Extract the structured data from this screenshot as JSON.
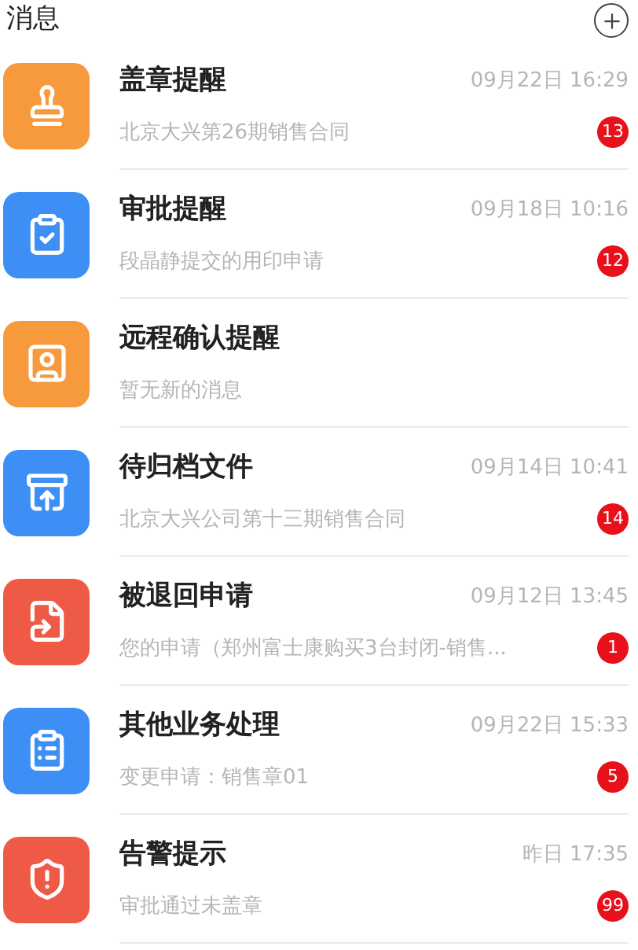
{
  "header": {
    "title": "消息"
  },
  "messages": [
    {
      "title": "盖章提醒",
      "time": "09月22日 16:29",
      "preview": "北京大兴第26期销售合同",
      "badge": "13",
      "color": "#f79a3e"
    },
    {
      "title": "审批提醒",
      "time": "09月18日 10:16",
      "preview": "段晶静提交的用印申请",
      "badge": "12",
      "color": "#3d8ff5"
    },
    {
      "title": "远程确认提醒",
      "preview": "暂无新的消息",
      "color": "#f79a3e"
    },
    {
      "title": "待归档文件",
      "time": "09月14日 10:41",
      "preview": "北京大兴公司第十三期销售合同",
      "badge": "14",
      "color": "#3d8ff5"
    },
    {
      "title": "被退回申请",
      "time": "09月12日 13:45",
      "preview": "您的申请（郑州富士康购买3台封闭-销售...",
      "badge": "1",
      "color": "#ef5a47"
    },
    {
      "title": "其他业务处理",
      "time": "09月22日 15:33",
      "preview": "变更申请：销售章01",
      "badge": "5",
      "color": "#3d8ff5"
    },
    {
      "title": "告警提示",
      "time": "昨日 17:35",
      "preview": "审批通过未盖章",
      "badge": "99",
      "color": "#ef5a47"
    }
  ]
}
